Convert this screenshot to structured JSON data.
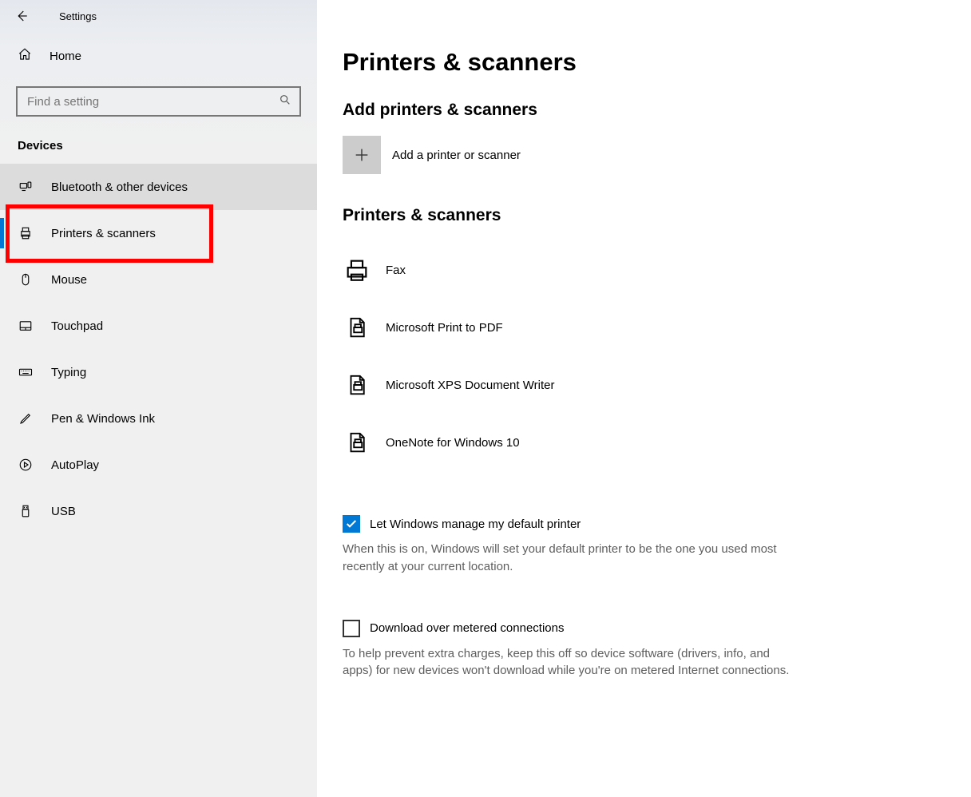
{
  "app_title": "Settings",
  "home_label": "Home",
  "search_placeholder": "Find a setting",
  "section_label": "Devices",
  "nav": [
    {
      "id": "bluetooth",
      "label": "Bluetooth & other devices"
    },
    {
      "id": "printers",
      "label": "Printers & scanners"
    },
    {
      "id": "mouse",
      "label": "Mouse"
    },
    {
      "id": "touchpad",
      "label": "Touchpad"
    },
    {
      "id": "typing",
      "label": "Typing"
    },
    {
      "id": "pen",
      "label": "Pen & Windows Ink"
    },
    {
      "id": "autoplay",
      "label": "AutoPlay"
    },
    {
      "id": "usb",
      "label": "USB"
    }
  ],
  "page_title": "Printers & scanners",
  "add_section_title": "Add printers & scanners",
  "add_button_label": "Add a printer or scanner",
  "list_section_title": "Printers & scanners",
  "devices": [
    {
      "label": "Fax"
    },
    {
      "label": "Microsoft Print to PDF"
    },
    {
      "label": "Microsoft XPS Document Writer"
    },
    {
      "label": "OneNote for Windows 10"
    }
  ],
  "default_printer": {
    "label": "Let Windows manage my default printer",
    "checked": true,
    "help": "When this is on, Windows will set your default printer to be the one you used most recently at your current location."
  },
  "metered": {
    "label": "Download over metered connections",
    "checked": false,
    "help": "To help prevent extra charges, keep this off so device software (drivers, info, and apps) for new devices won't download while you're on metered Internet connections."
  }
}
